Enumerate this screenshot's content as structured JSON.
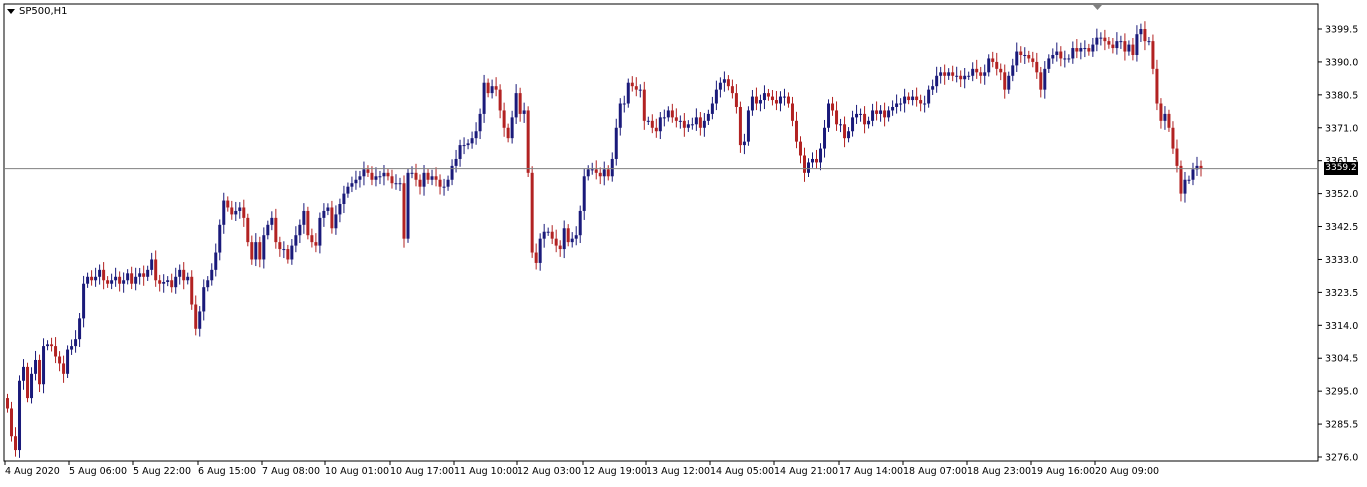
{
  "window": {
    "title": "SP500,H1"
  },
  "colors": {
    "bull": "#1a1a7a",
    "bear": "#b22222",
    "grid": "#000000",
    "last_price_line": "#808080"
  },
  "icons": {
    "title_dropdown": "triangle-down-icon",
    "shift_marker": "triangle-down-icon"
  },
  "chart_data": {
    "type": "candlestick",
    "symbol": "SP500",
    "timeframe": "H1",
    "last_price": 3359.2,
    "last_price_label": "3359.2",
    "ylim": [
      3274.5,
      3404.0
    ],
    "y_ticks": [
      "3399.5",
      "3390.0",
      "3380.5",
      "3371.0",
      "3361.5",
      "3352.0",
      "3342.5",
      "3333.0",
      "3323.5",
      "3314.0",
      "3304.5",
      "3295.0",
      "3285.5",
      "3276.0"
    ],
    "x_ticks": [
      "4 Aug 2020",
      "5 Aug 06:00",
      "5 Aug 22:00",
      "6 Aug 15:00",
      "7 Aug 08:00",
      "10 Aug 01:00",
      "10 Aug 17:00",
      "11 Aug 10:00",
      "12 Aug 03:00",
      "12 Aug 19:00",
      "13 Aug 12:00",
      "14 Aug 05:00",
      "14 Aug 21:00",
      "17 Aug 14:00",
      "18 Aug 07:00",
      "18 Aug 23:00",
      "19 Aug 16:00",
      "20 Aug 09:00"
    ],
    "grid": false,
    "closes": [
      3290.0,
      3282.0,
      3278.0,
      3298.0,
      3302.0,
      3293.0,
      3300.0,
      3304.0,
      3297.0,
      3308.0,
      3308.5,
      3308.0,
      3305.0,
      3303.0,
      3300.0,
      3307.0,
      3308.0,
      3310.0,
      3316.0,
      3326.0,
      3328.0,
      3327.0,
      3328.0,
      3330.0,
      3327.0,
      3326.0,
      3327.0,
      3328.0,
      3326.0,
      3327.0,
      3329.0,
      3326.0,
      3328.0,
      3329.0,
      3328.0,
      3330.0,
      3333.0,
      3327.0,
      3326.0,
      3326.5,
      3327.0,
      3325.0,
      3328.0,
      3330.0,
      3327.0,
      3328.0,
      3320.0,
      3313.0,
      3318.0,
      3325.0,
      3327.0,
      3330.0,
      3335.0,
      3343.0,
      3350.0,
      3348.0,
      3346.0,
      3347.0,
      3348.0,
      3345.0,
      3338.0,
      3333.0,
      3338.0,
      3333.0,
      3340.0,
      3343.0,
      3345.0,
      3338.0,
      3336.0,
      3336.0,
      3333.0,
      3337.0,
      3340.0,
      3343.0,
      3347.0,
      3340.0,
      3338.0,
      3337.0,
      3345.0,
      3347.0,
      3348.0,
      3342.0,
      3346.0,
      3349.0,
      3352.0,
      3354.0,
      3355.0,
      3356.0,
      3357.0,
      3359.0,
      3358.0,
      3356.0,
      3357.0,
      3357.0,
      3358.0,
      3357.0,
      3355.0,
      3355.0,
      3355.0,
      3339.0,
      3358.0,
      3358.0,
      3356.0,
      3354.0,
      3358.0,
      3356.0,
      3357.0,
      3356.0,
      3354.0,
      3354.0,
      3356.0,
      3360.0,
      3362.0,
      3366.0,
      3366.0,
      3366.5,
      3368.0,
      3370.0,
      3375.0,
      3384.0,
      3381.0,
      3383.0,
      3382.0,
      3376.0,
      3371.0,
      3368.0,
      3374.0,
      3381.0,
      3375.0,
      3376.0,
      3358.0,
      3335.0,
      3332.0,
      3339.0,
      3341.0,
      3341.0,
      3339.0,
      3337.0,
      3336.0,
      3342.0,
      3338.0,
      3339.0,
      3340.0,
      3347.0,
      3357.0,
      3359.0,
      3359.0,
      3358.0,
      3357.0,
      3359.0,
      3357.0,
      3362.0,
      3371.0,
      3378.0,
      3378.0,
      3384.0,
      3383.0,
      3382.0,
      3382.0,
      3373.0,
      3373.0,
      3371.0,
      3370.0,
      3374.0,
      3374.0,
      3376.0,
      3374.0,
      3373.0,
      3373.0,
      3371.0,
      3372.0,
      3372.0,
      3374.0,
      3371.0,
      3373.0,
      3375.0,
      3378.0,
      3382.0,
      3384.0,
      3385.0,
      3383.0,
      3381.0,
      3377.0,
      3366.0,
      3367.0,
      3376.0,
      3380.0,
      3378.0,
      3379.0,
      3381.0,
      3380.0,
      3379.0,
      3378.0,
      3380.0,
      3380.0,
      3378.0,
      3373.0,
      3367.0,
      3363.0,
      3358.0,
      3361.0,
      3362.0,
      3361.0,
      3365.0,
      3371.0,
      3378.0,
      3376.0,
      3372.0,
      3372.0,
      3368.0,
      3370.0,
      3374.0,
      3375.0,
      3375.0,
      3372.0,
      3373.0,
      3376.0,
      3375.0,
      3376.0,
      3374.0,
      3376.0,
      3377.0,
      3378.0,
      3378.0,
      3380.0,
      3379.0,
      3380.0,
      3379.0,
      3378.0,
      3378.0,
      3382.0,
      3383.0,
      3386.0,
      3387.0,
      3386.0,
      3387.0,
      3386.0,
      3386.0,
      3385.0,
      3386.0,
      3386.0,
      3388.0,
      3387.0,
      3386.0,
      3387.0,
      3391.0,
      3390.0,
      3388.0,
      3387.0,
      3382.0,
      3386.0,
      3389.0,
      3393.0,
      3392.0,
      3392.0,
      3391.0,
      3390.0,
      3387.0,
      3382.0,
      3388.0,
      3391.0,
      3392.0,
      3393.0,
      3391.0,
      3391.0,
      3391.0,
      3394.0,
      3393.0,
      3394.0,
      3394.0,
      3393.0,
      3395.0,
      3397.0,
      3397.0,
      3396.0,
      3395.0,
      3394.0,
      3396.0,
      3396.0,
      3393.0,
      3395.0,
      3392.0,
      3398.0,
      3399.5,
      3396.0,
      3396.0,
      3388.0,
      3378.0,
      3373.0,
      3375.0,
      3371.0,
      3365.0,
      3360.0,
      3352.0,
      3356.0,
      3356.0,
      3359.0,
      3360.0,
      3359.2
    ]
  }
}
